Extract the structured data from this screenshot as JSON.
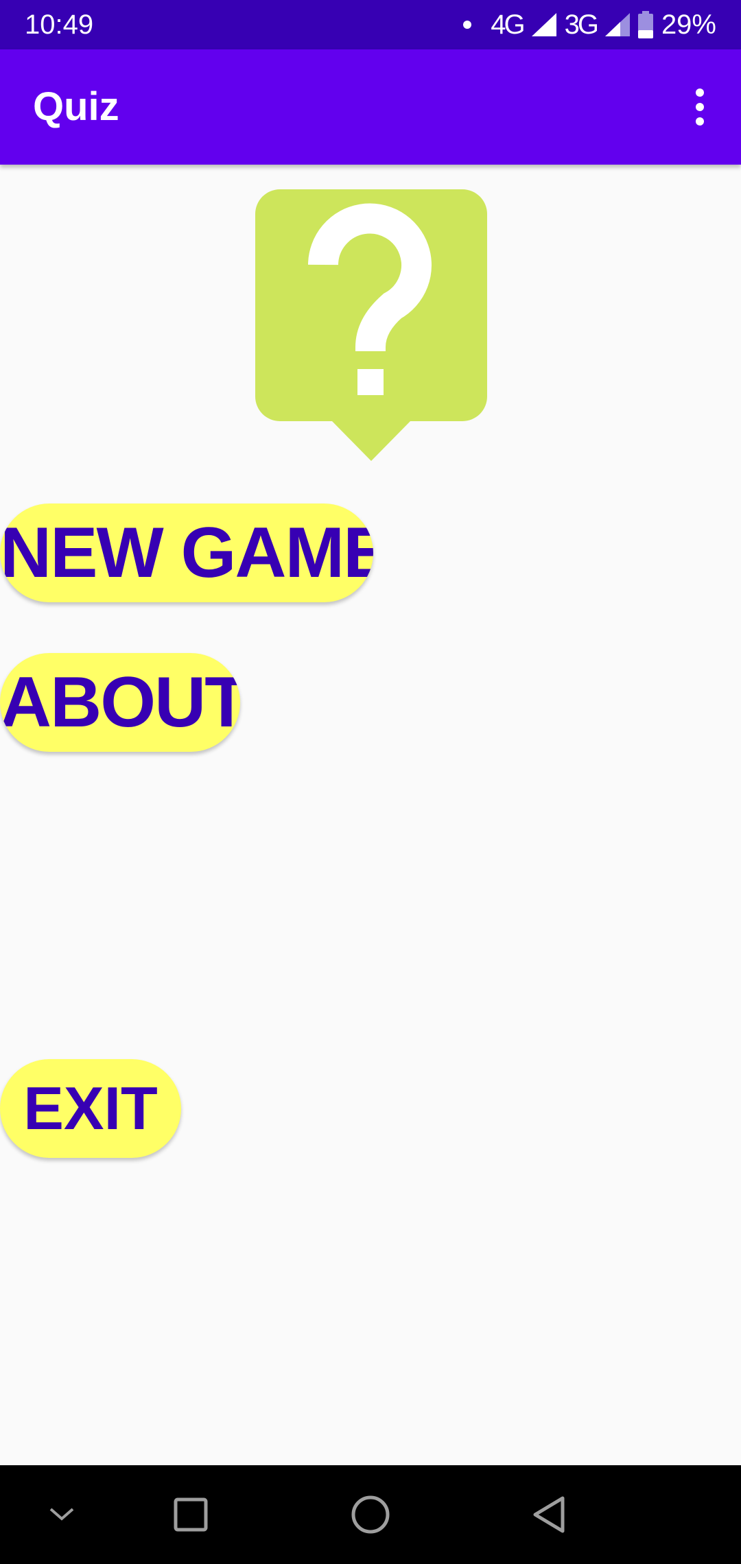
{
  "status_bar": {
    "time": "10:49",
    "network_primary": "4G",
    "network_secondary": "3G",
    "battery": "29%",
    "icons": [
      "notification-dot-icon",
      "signal-4g-icon",
      "signal-3g-icon",
      "battery-icon"
    ]
  },
  "app_bar": {
    "title": "Quiz",
    "overflow_icon": "more-vert-icon"
  },
  "logo": {
    "icon": "question-bubble-icon",
    "bubble_color": "#cde55b",
    "glyph_color": "#ffffff"
  },
  "menu": {
    "new_game_label": "NEW GAME",
    "about_label": "ABOUT",
    "exit_label": "EXIT",
    "button_color": "#ffff66",
    "text_color": "#3700b3"
  },
  "nav_bar": {
    "icons": [
      "chevron-down-icon",
      "recents-square-icon",
      "home-circle-icon",
      "back-triangle-icon"
    ]
  },
  "colors": {
    "status_bar": "#3700b3",
    "app_bar": "#6200ee",
    "background": "#fafafa",
    "nav_bar": "#000000"
  }
}
